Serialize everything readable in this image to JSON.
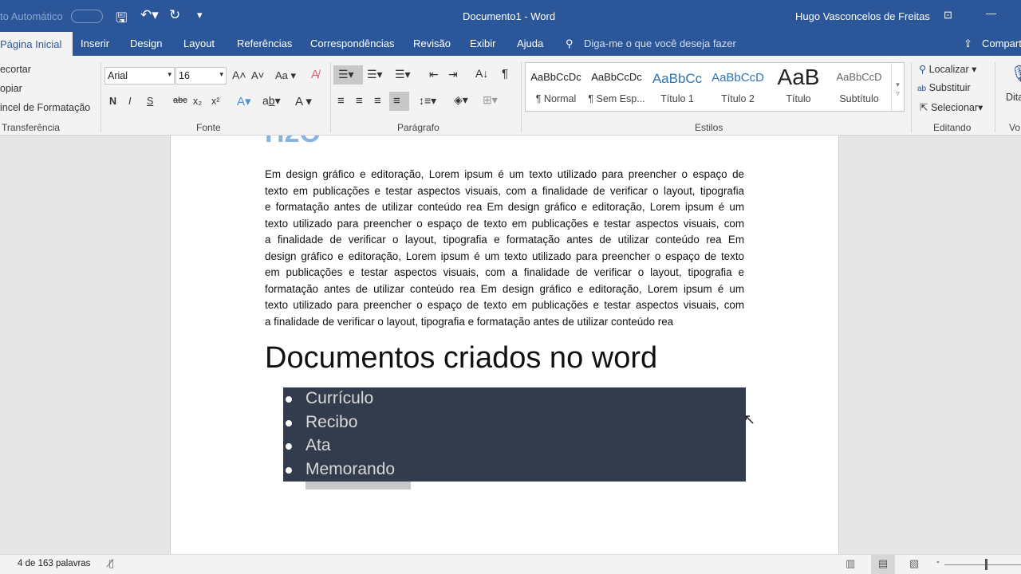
{
  "titlebar": {
    "autosave": "to Automático",
    "title": "Documento1 - Word",
    "user": "Hugo Vasconcelos de Freitas"
  },
  "tabs": [
    "Página Inicial",
    "Inserir",
    "Design",
    "Layout",
    "Referências",
    "Correspondências",
    "Revisão",
    "Exibir",
    "Ajuda"
  ],
  "tell_me": "Diga-me o que você deseja fazer",
  "share": "Compart",
  "clipboard": {
    "cut": "ecortar",
    "copy": "opiar",
    "painter": "incel de Formatação",
    "label": "Transferência"
  },
  "font": {
    "name": "Arial",
    "size": "16",
    "label": "Fonte",
    "bold": "N",
    "italic": "I",
    "underline": "S",
    "case": "Aa"
  },
  "paragraph": {
    "label": "Parágrafo"
  },
  "styles": {
    "label": "Estilos",
    "items": [
      {
        "preview": "AaBbCcDc",
        "name": "¶ Normal"
      },
      {
        "preview": "AaBbCcDc",
        "name": "¶ Sem Esp..."
      },
      {
        "preview": "AaBbCc",
        "name": "Título 1"
      },
      {
        "preview": "AaBbCcD",
        "name": "Título 2"
      },
      {
        "preview": "AaB",
        "name": "Título"
      },
      {
        "preview": "AaBbCcD",
        "name": "Subtítulo"
      }
    ]
  },
  "editing": {
    "find": "Localizar",
    "replace": "Substituir",
    "select": "Selecionar",
    "label": "Editando"
  },
  "voice": {
    "dictate": "Dita",
    "label": "Vo"
  },
  "document": {
    "partial_heading": "H2O",
    "paragraph_lines": [
      "Em design gráfico e editoração, Lorem ipsum é um texto utilizado para preencher o espaço de",
      "texto em publicações e testar aspectos visuais, com a finalidade de verificar o layout, tipografia",
      "e formatação antes de utilizar conteúdo rea Em design gráfico e editoração, Lorem ipsum é um",
      "texto utilizado para preencher o espaço de texto em publicações e testar aspectos visuais, com",
      "a finalidade de verificar o layout, tipografia e formatação antes de utilizar conteúdo rea Em",
      "design gráfico e editoração, Lorem ipsum é um texto utilizado para preencher o espaço de texto",
      "em publicações e testar aspectos visuais, com a finalidade de verificar o layout, tipografia e",
      "formatação antes de utilizar conteúdo rea Em design gráfico e editoração, Lorem ipsum é um",
      "texto utilizado para preencher o espaço de texto em publicações e testar aspectos visuais, com",
      "a finalidade de verificar o layout, tipografia e formatação antes de utilizar conteúdo rea"
    ],
    "heading": "Documentos criados no word",
    "list": [
      "Currículo",
      "Recibo",
      "Ata",
      "Memorando"
    ]
  },
  "status": {
    "words": "4 de 163 palavras"
  },
  "colors": {
    "accent": "#2b579a",
    "selection": "#333c4c"
  }
}
